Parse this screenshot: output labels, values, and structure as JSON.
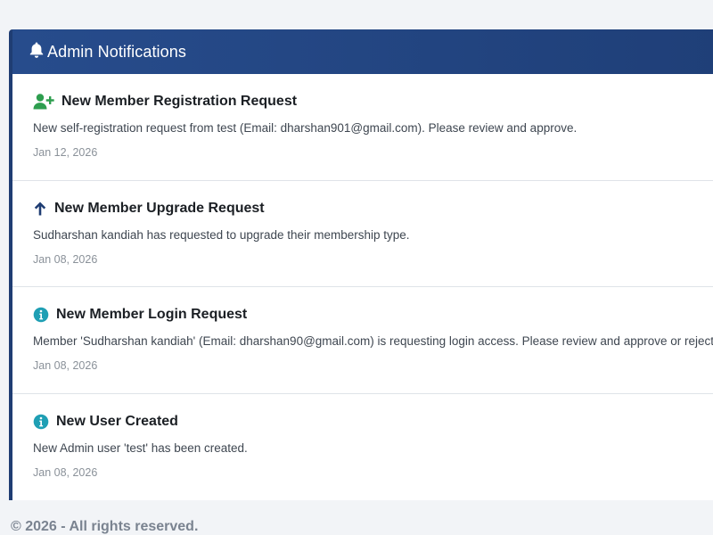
{
  "panel": {
    "title": "Admin Notifications",
    "icon": "bell-icon"
  },
  "notifications": [
    {
      "icon": "user-plus-icon",
      "icon_color": "#2e9e4f",
      "title": "New Member Registration Request",
      "message": "New self-registration request from test (Email: dharshan901@gmail.com). Please review and approve.",
      "date": "Jan 12, 2026"
    },
    {
      "icon": "arrow-up-icon",
      "icon_color": "#1f3d73",
      "title": "New Member Upgrade Request",
      "message": "Sudharshan kandiah has requested to upgrade their membership type.",
      "date": "Jan 08, 2026"
    },
    {
      "icon": "info-circle-icon",
      "icon_color": "#1f9fb4",
      "title": "New Member Login Request",
      "message": "Member 'Sudharshan kandiah' (Email: dharshan90@gmail.com) is requesting login access. Please review and approve or reject.",
      "date": "Jan 08, 2026"
    },
    {
      "icon": "info-circle-icon",
      "icon_color": "#1f9fb4",
      "title": "New User Created",
      "message": "New Admin user 'test' has been created.",
      "date": "Jan 08, 2026"
    }
  ],
  "footer": {
    "text": "© 2026 - All rights reserved."
  },
  "colors": {
    "header_bg": "#274c8c",
    "accent_border": "#1f3d73"
  }
}
